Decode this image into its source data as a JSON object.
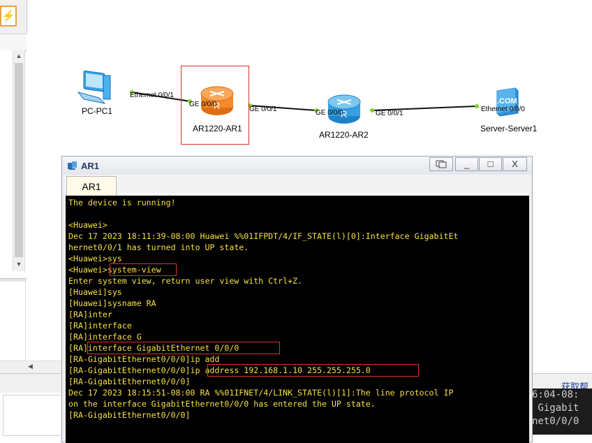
{
  "left_toolbar": {
    "flash_icon": "lightning-icon"
  },
  "topology": {
    "devices": [
      {
        "label": "PC-PC1",
        "icon": "pc-icon"
      },
      {
        "label": "AR1220-AR1",
        "icon": "router-icon",
        "color": "#f28a2e"
      },
      {
        "label": "AR1220-AR2",
        "icon": "router-icon",
        "color": "#36a0e0"
      },
      {
        "label": "Server-Server1",
        "icon": "server-icon"
      }
    ],
    "ports": {
      "pc1": "Ethernet 0/0/1",
      "ar1_left": "GE 0/0/0",
      "ar1_right": "GE 0/0/1",
      "ar2_left": "GE 0/0/0",
      "ar2_right": "GE 0/0/1",
      "server": "Ethernet 0/0/0"
    },
    "server_badge": ".COM",
    "link_dot_color": "#7ed321"
  },
  "console_window": {
    "title": "AR1",
    "tab_label": "AR1",
    "controls": {
      "restore": "restore-icon",
      "minimize": "_",
      "maximize": "□",
      "close": "X"
    },
    "lines": [
      "The device is running!",
      "",
      "<Huawei>",
      "Dec 17 2023 18:11:39-08:00 Huawei %%01IFPDT/4/IF_STATE(l)[0]:Interface GigabitEt",
      "hernet0/0/1 has turned into UP state.",
      "<Huawei>sys",
      "<Huawei>system-view",
      "Enter system view, return user view with Ctrl+Z.",
      "[Huawei]sys",
      "[Huawei]sysname RA",
      "[RA]inter",
      "[RA]interface",
      "[RA]interface G",
      "[RA]interface GigabitEthernet 0/0/0",
      "[RA-GigabitEthernet0/0/0]ip add",
      "[RA-GigabitEthernet0/0/0]ip address 192.168.1.10 255.255.255.0",
      "[RA-GigabitEthernet0/0/0]",
      "Dec 17 2023 18:15:51-08:00 RA %%01IFNET/4/LINK_STATE(l)[1]:The line protocol IP",
      "on the interface GigabitEthernet0/0/0 has entered the UP state.",
      "[RA-GigabitEthernet0/0/0]"
    ],
    "text_color": "#f5e042",
    "highlight_color": "#e33030"
  },
  "bottom": {
    "help_link": "获取帮",
    "side_terminal_lines": [
      "6:04-08:",
      " Gigabit",
      "net0/0/0"
    ]
  }
}
